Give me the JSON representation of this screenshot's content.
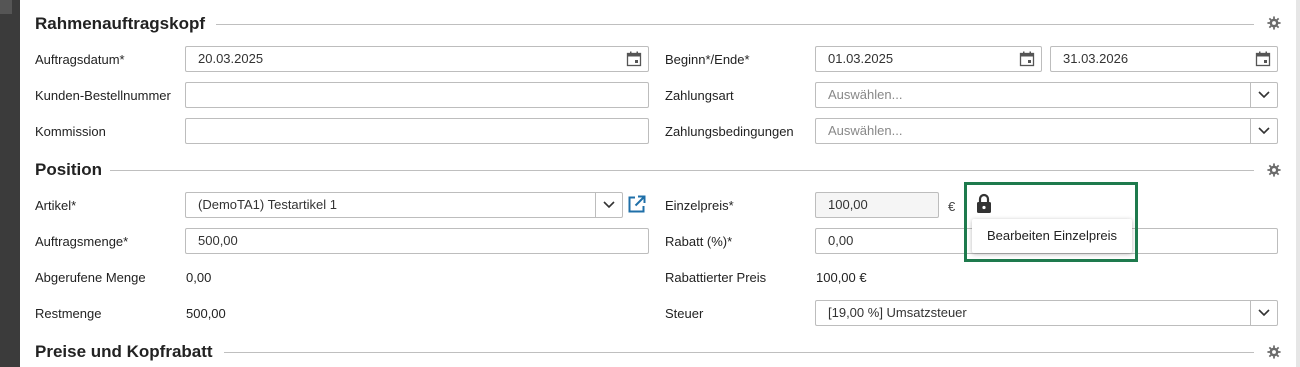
{
  "sections": {
    "header_title": "Rahmenauftragskopf",
    "position_title": "Position",
    "prices_title": "Preise und Kopfrabatt"
  },
  "header": {
    "order_date_label": "Auftragsdatum*",
    "order_date_value": "20.03.2025",
    "customer_order_no_label": "Kunden-Bestellnummer",
    "customer_order_no_value": "",
    "commission_label": "Kommission",
    "commission_value": "",
    "start_end_label": "Beginn*/Ende*",
    "start_value": "01.03.2025",
    "end_value": "31.03.2026",
    "payment_method_label": "Zahlungsart",
    "payment_method_placeholder": "Auswählen...",
    "payment_terms_label": "Zahlungsbedingungen",
    "payment_terms_placeholder": "Auswählen..."
  },
  "position": {
    "article_label": "Artikel*",
    "article_value": "(DemoTA1) Testartikel 1",
    "order_qty_label": "Auftragsmenge*",
    "order_qty_value": "500,00",
    "called_qty_label": "Abgerufene Menge",
    "called_qty_value": "0,00",
    "remaining_qty_label": "Restmenge",
    "remaining_qty_value": "500,00",
    "unit_price_label": "Einzelpreis*",
    "unit_price_value": "100,00",
    "currency": "€",
    "discount_label": "Rabatt (%)*",
    "discount_value": "0,00",
    "discounted_price_label": "Rabattierter Preis",
    "discounted_price_value": "100,00 €",
    "tax_label": "Steuer",
    "tax_value": "[19,00 %] Umsatzsteuer"
  },
  "popover": {
    "edit_unit_price": "Bearbeiten Einzelpreis"
  },
  "colors": {
    "highlight": "#1e7a4d",
    "link_icon": "#1f6fa8"
  },
  "icons": [
    "calendar-icon",
    "chevron-down-icon",
    "gear-icon",
    "external-link-icon",
    "lock-icon"
  ]
}
